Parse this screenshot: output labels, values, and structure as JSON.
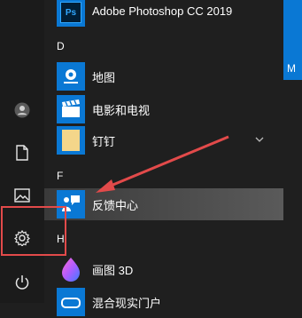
{
  "apps": {
    "photoshop": "Adobe Photoshop CC 2019",
    "section_d": "D",
    "maps": "地图",
    "movies": "电影和电视",
    "dingtalk": "钉钉",
    "section_f": "F",
    "feedback": "反馈中心",
    "section_h": "H",
    "paint3d": "画图 3D",
    "mixed_reality": "混合现实门户"
  },
  "right_panel": {
    "letter": "M"
  },
  "colors": {
    "accent": "#0a78d4",
    "highlight_box": "#e24a4a"
  }
}
